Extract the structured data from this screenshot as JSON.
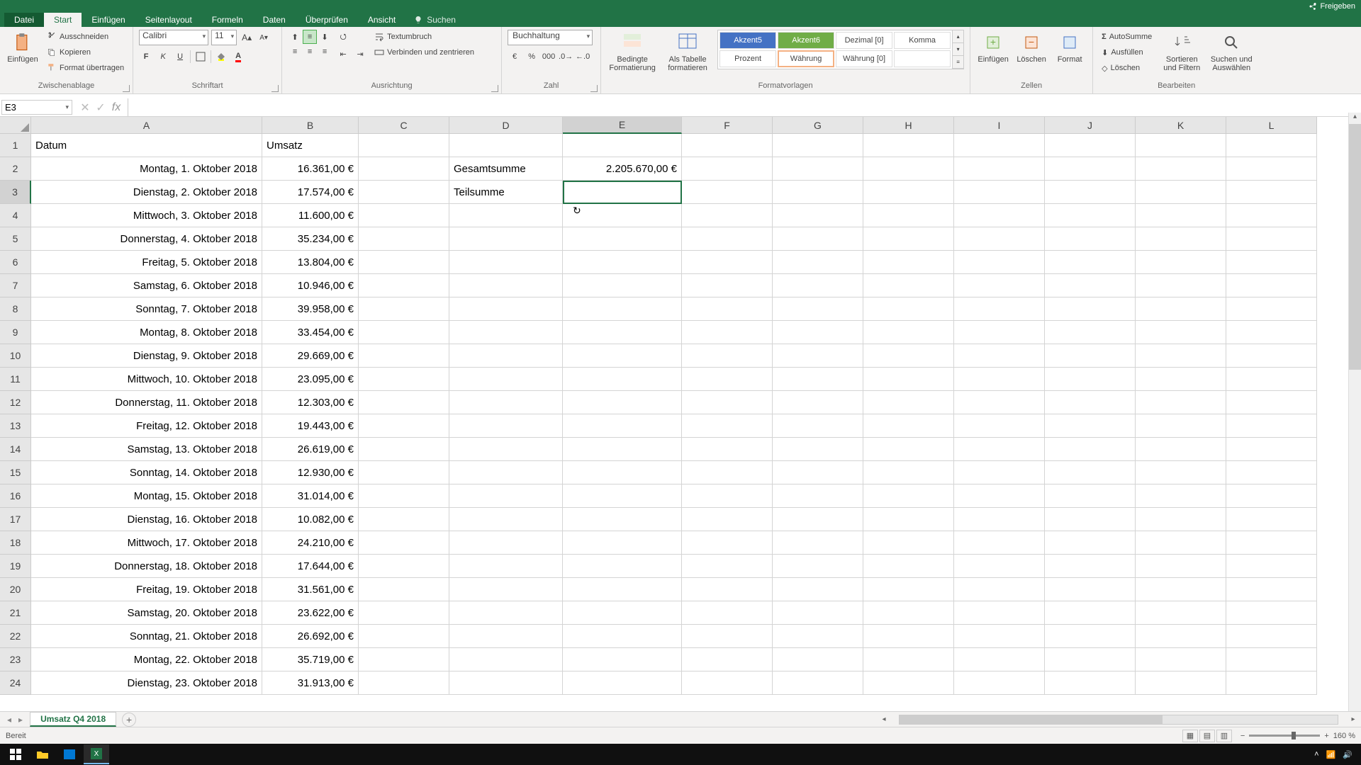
{
  "titlebar": {
    "share": "Freigeben"
  },
  "tabs": {
    "file": "Datei",
    "home": "Start",
    "insert": "Einfügen",
    "layout": "Seitenlayout",
    "formulas": "Formeln",
    "data": "Daten",
    "review": "Überprüfen",
    "view": "Ansicht",
    "search": "Suchen"
  },
  "ribbon": {
    "paste": "Einfügen",
    "cut": "Ausschneiden",
    "copy": "Kopieren",
    "painter": "Format übertragen",
    "clipboard_label": "Zwischenablage",
    "font_name": "Calibri",
    "font_size": "11",
    "font_label": "Schriftart",
    "wrap": "Textumbruch",
    "merge": "Verbinden und zentrieren",
    "align_label": "Ausrichtung",
    "number_format": "Buchhaltung",
    "number_label": "Zahl",
    "cond": "Bedingte Formatierung",
    "table": "Als Tabelle formatieren",
    "styles": {
      "akzent5": "Akzent5",
      "akzent6": "Akzent6",
      "dezimal": "Dezimal [0]",
      "komma": "Komma",
      "prozent": "Prozent",
      "waehrung_sel": "Währung",
      "waehrung0": "Währung [0]"
    },
    "styles_label": "Formatvorlagen",
    "cell_insert": "Einfügen",
    "cell_delete": "Löschen",
    "cell_format": "Format",
    "cells_label": "Zellen",
    "autosum": "AutoSumme",
    "fill": "Ausfüllen",
    "clear": "Löschen",
    "sort": "Sortieren und Filtern",
    "find": "Suchen und Auswählen",
    "edit_label": "Bearbeiten"
  },
  "namebox": "E3",
  "formula": "",
  "columns": [
    "A",
    "B",
    "C",
    "D",
    "E",
    "F",
    "G",
    "H",
    "I",
    "J",
    "K",
    "L"
  ],
  "headers": {
    "A": "Datum",
    "B": "Umsatz"
  },
  "side": {
    "D2": "Gesamtsumme",
    "E2": "2.205.670,00 €",
    "D3": "Teilsumme"
  },
  "rows": [
    {
      "n": 1
    },
    {
      "n": 2,
      "A": "Montag, 1. Oktober 2018",
      "B": "16.361,00 €"
    },
    {
      "n": 3,
      "A": "Dienstag, 2. Oktober 2018",
      "B": "17.574,00 €"
    },
    {
      "n": 4,
      "A": "Mittwoch, 3. Oktober 2018",
      "B": "11.600,00 €"
    },
    {
      "n": 5,
      "A": "Donnerstag, 4. Oktober 2018",
      "B": "35.234,00 €"
    },
    {
      "n": 6,
      "A": "Freitag, 5. Oktober 2018",
      "B": "13.804,00 €"
    },
    {
      "n": 7,
      "A": "Samstag, 6. Oktober 2018",
      "B": "10.946,00 €"
    },
    {
      "n": 8,
      "A": "Sonntag, 7. Oktober 2018",
      "B": "39.958,00 €"
    },
    {
      "n": 9,
      "A": "Montag, 8. Oktober 2018",
      "B": "33.454,00 €"
    },
    {
      "n": 10,
      "A": "Dienstag, 9. Oktober 2018",
      "B": "29.669,00 €"
    },
    {
      "n": 11,
      "A": "Mittwoch, 10. Oktober 2018",
      "B": "23.095,00 €"
    },
    {
      "n": 12,
      "A": "Donnerstag, 11. Oktober 2018",
      "B": "12.303,00 €"
    },
    {
      "n": 13,
      "A": "Freitag, 12. Oktober 2018",
      "B": "19.443,00 €"
    },
    {
      "n": 14,
      "A": "Samstag, 13. Oktober 2018",
      "B": "26.619,00 €"
    },
    {
      "n": 15,
      "A": "Sonntag, 14. Oktober 2018",
      "B": "12.930,00 €"
    },
    {
      "n": 16,
      "A": "Montag, 15. Oktober 2018",
      "B": "31.014,00 €"
    },
    {
      "n": 17,
      "A": "Dienstag, 16. Oktober 2018",
      "B": "10.082,00 €"
    },
    {
      "n": 18,
      "A": "Mittwoch, 17. Oktober 2018",
      "B": "24.210,00 €"
    },
    {
      "n": 19,
      "A": "Donnerstag, 18. Oktober 2018",
      "B": "17.644,00 €"
    },
    {
      "n": 20,
      "A": "Freitag, 19. Oktober 2018",
      "B": "31.561,00 €"
    },
    {
      "n": 21,
      "A": "Samstag, 20. Oktober 2018",
      "B": "23.622,00 €"
    },
    {
      "n": 22,
      "A": "Sonntag, 21. Oktober 2018",
      "B": "26.692,00 €"
    },
    {
      "n": 23,
      "A": "Montag, 22. Oktober 2018",
      "B": "35.719,00 €"
    },
    {
      "n": 24,
      "A": "Dienstag, 23. Oktober 2018",
      "B": "31.913,00 €"
    }
  ],
  "sheet_tab": "Umsatz Q4 2018",
  "status": "Bereit",
  "zoom": "160 %"
}
